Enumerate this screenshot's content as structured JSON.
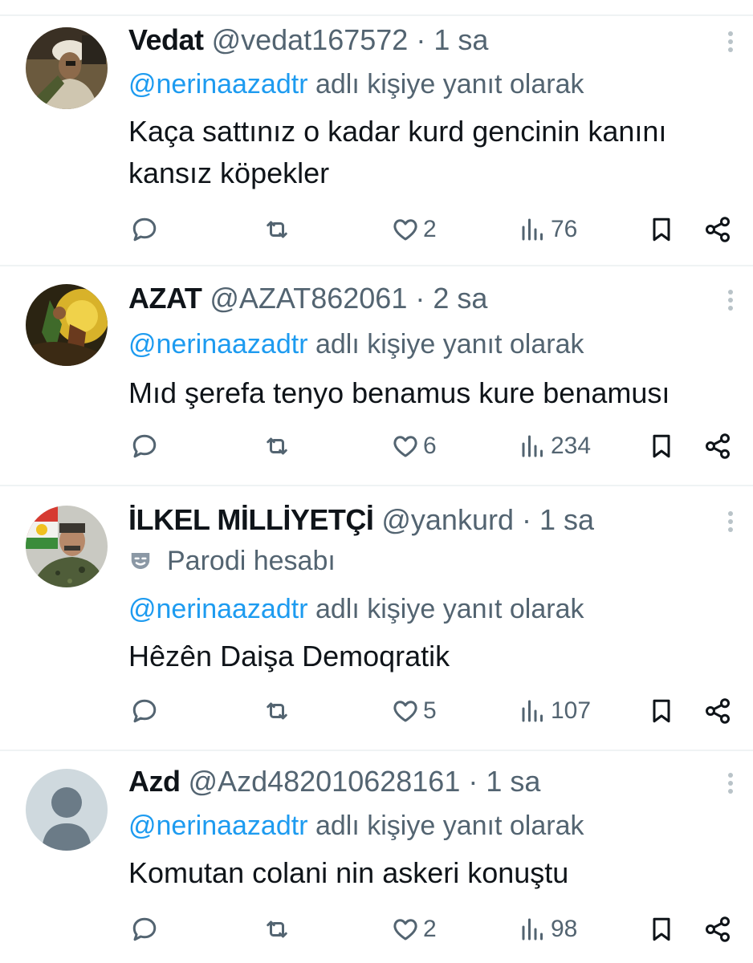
{
  "reply_prefix_text": "adlı kişiye yanıt olarak",
  "colors": {
    "mention": "#1d9bf0",
    "secondary": "#536471",
    "divider": "#eff3f4"
  },
  "tweets": [
    {
      "name": "Vedat",
      "handle": "@vedat167572",
      "separator": "·",
      "time": "1 sa",
      "reply_to": "@nerinaazadtr",
      "text": "Kaça sattınız o kadar kurd gencinin kanını kansız köpekler",
      "likes": "2",
      "views": "76",
      "avatar": "photo-avatar"
    },
    {
      "name": "AZAT",
      "handle": "@AZAT862061",
      "separator": "·",
      "time": "2 sa",
      "reply_to": "@nerinaazadtr",
      "text": "Mıd şerefa tenyo benamus kure benamusı",
      "likes": "6",
      "views": "234",
      "avatar": "photo-avatar"
    },
    {
      "name": "İLKEL MİLLİYETÇİ",
      "handle": "@yankurd",
      "separator": "·",
      "time": "1 sa",
      "badge": "Parodi hesabı",
      "badge_icon": "parody-mask-icon",
      "reply_to": "@nerinaazadtr",
      "text": "Hêzên Daişa Demoqratik",
      "likes": "5",
      "views": "107",
      "avatar": "photo-avatar"
    },
    {
      "name": "Azd",
      "handle": "@Azd482010628161",
      "separator": "·",
      "time": "1 sa",
      "reply_to": "@nerinaazadtr",
      "text": "Komutan colani nin askeri konuştu",
      "likes": "2",
      "views": "98",
      "avatar": "default-avatar"
    }
  ],
  "icons": {
    "reply": "reply-icon",
    "repost": "repost-icon",
    "like": "heart-icon",
    "views": "views-icon",
    "bookmark": "bookmark-icon",
    "share": "share-icon",
    "more": "more-icon"
  }
}
